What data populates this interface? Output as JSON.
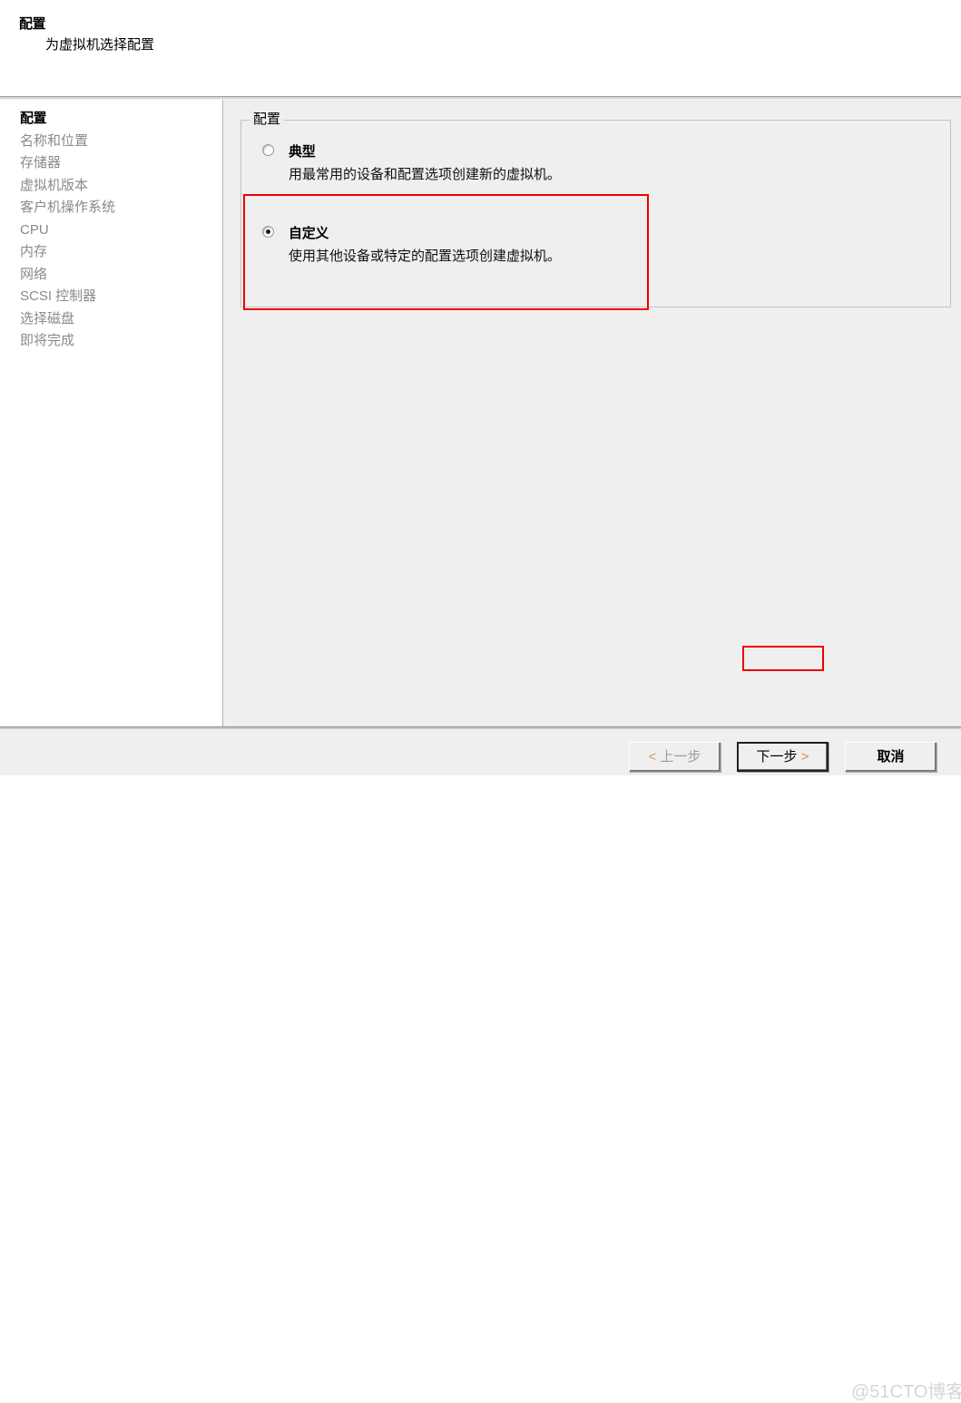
{
  "header": {
    "title": "配置",
    "subtitle": "为虚拟机选择配置"
  },
  "sidebar": {
    "items": [
      {
        "label": "配置",
        "active": true
      },
      {
        "label": "名称和位置",
        "active": false
      },
      {
        "label": "存储器",
        "active": false
      },
      {
        "label": "虚拟机版本",
        "active": false
      },
      {
        "label": "客户机操作系统",
        "active": false
      },
      {
        "label": "CPU",
        "active": false
      },
      {
        "label": "内存",
        "active": false
      },
      {
        "label": "网络",
        "active": false
      },
      {
        "label": "SCSI 控制器",
        "active": false
      },
      {
        "label": "选择磁盘",
        "active": false
      },
      {
        "label": "即将完成",
        "active": false
      }
    ]
  },
  "main": {
    "groupbox_legend": "配置",
    "options": [
      {
        "label": "典型",
        "description": "用最常用的设备和配置选项创建新的虚拟机。",
        "selected": false
      },
      {
        "label": "自定义",
        "description": "使用其他设备或特定的配置选项创建虚拟机。",
        "selected": true
      }
    ]
  },
  "footer": {
    "back_arrow": "<",
    "back_label": "上一步",
    "next_label": "下一步",
    "next_arrow": ">",
    "cancel_label": "取消"
  },
  "annotations": {
    "color": "#ee0000",
    "targets": [
      "自定义",
      "下一步 >"
    ]
  },
  "watermark": {
    "text": "@51CTO博客"
  }
}
